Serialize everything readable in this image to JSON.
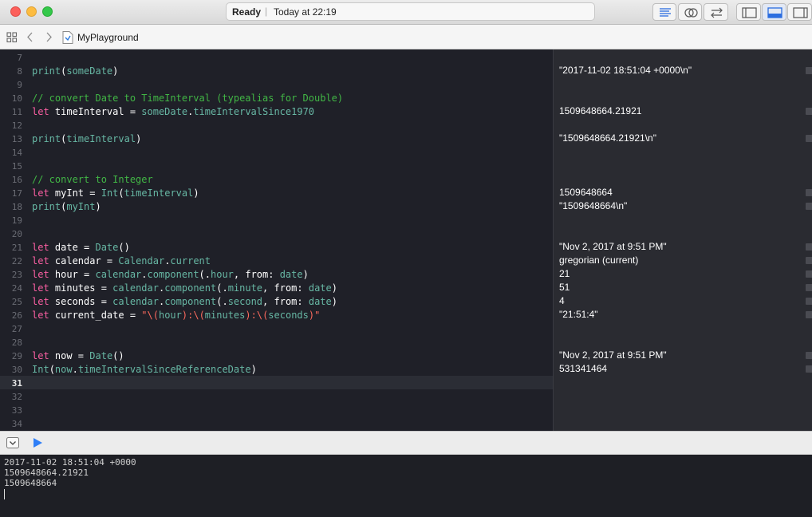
{
  "titlebar": {
    "status": "Ready",
    "separator": "|",
    "time": "Today at 22:19"
  },
  "navbar": {
    "filename": "MyPlayground"
  },
  "editor": {
    "line_numbers": [
      "7",
      "8",
      "9",
      "10",
      "11",
      "12",
      "13",
      "14",
      "15",
      "16",
      "17",
      "18",
      "19",
      "20",
      "21",
      "22",
      "23",
      "24",
      "25",
      "26",
      "27",
      "28",
      "29",
      "30",
      "31",
      "32",
      "33",
      "34"
    ],
    "active_line": "31",
    "lines": {
      "l8": "print(someDate)",
      "l10": "// convert Date to TimeInterval (typealias for Double)",
      "l11": "let timeInterval = someDate.timeIntervalSince1970",
      "l13": "print(timeInterval)",
      "l16": "// convert to Integer",
      "l17": "let myInt = Int(timeInterval)",
      "l18": "print(myInt)",
      "l21": "let date = Date()",
      "l22": "let calendar = Calendar.current",
      "l23": "let hour = calendar.component(.hour, from: date)",
      "l24": "let minutes = calendar.component(.minute, from: date)",
      "l25": "let seconds = calendar.component(.second, from: date)",
      "l26": "let current_date = \"\\(hour):\\(minutes):\\(seconds)\"",
      "l29": "let now = Date()",
      "l30": "Int(now.timeIntervalSinceReferenceDate)"
    }
  },
  "results": {
    "r8": "\"2017-11-02 18:51:04 +0000\\n\"",
    "r11": "1509648664.21921",
    "r13": "\"1509648664.21921\\n\"",
    "r17": "1509648664",
    "r18": "\"1509648664\\n\"",
    "r21": "\"Nov 2, 2017 at 9:51 PM\"",
    "r22": "gregorian (current)",
    "r23": "21",
    "r24": "51",
    "r25": "4",
    "r26": "\"21:51:4\"",
    "r29": "\"Nov 2, 2017 at 9:51 PM\"",
    "r30": "531341464"
  },
  "console": {
    "lines": [
      "2017-11-02 18:51:04 +0000",
      "1509648664.21921",
      "1509648664"
    ]
  },
  "colors": {
    "keyword": "#fc5fa3",
    "function": "#67b7a4",
    "comment": "#41b645",
    "string": "#fc6a5d",
    "run_button": "#2f7ff7"
  },
  "icons": [
    "close-icon",
    "minimize-icon",
    "zoom-icon",
    "standard-editor-icon",
    "assistant-editor-icon",
    "version-editor-icon",
    "navigator-toggle-icon",
    "debug-area-toggle-icon",
    "utilities-toggle-icon",
    "grid-icon",
    "back-chevron-icon",
    "forward-chevron-icon",
    "playground-file-icon",
    "hide-debug-icon",
    "run-icon"
  ]
}
